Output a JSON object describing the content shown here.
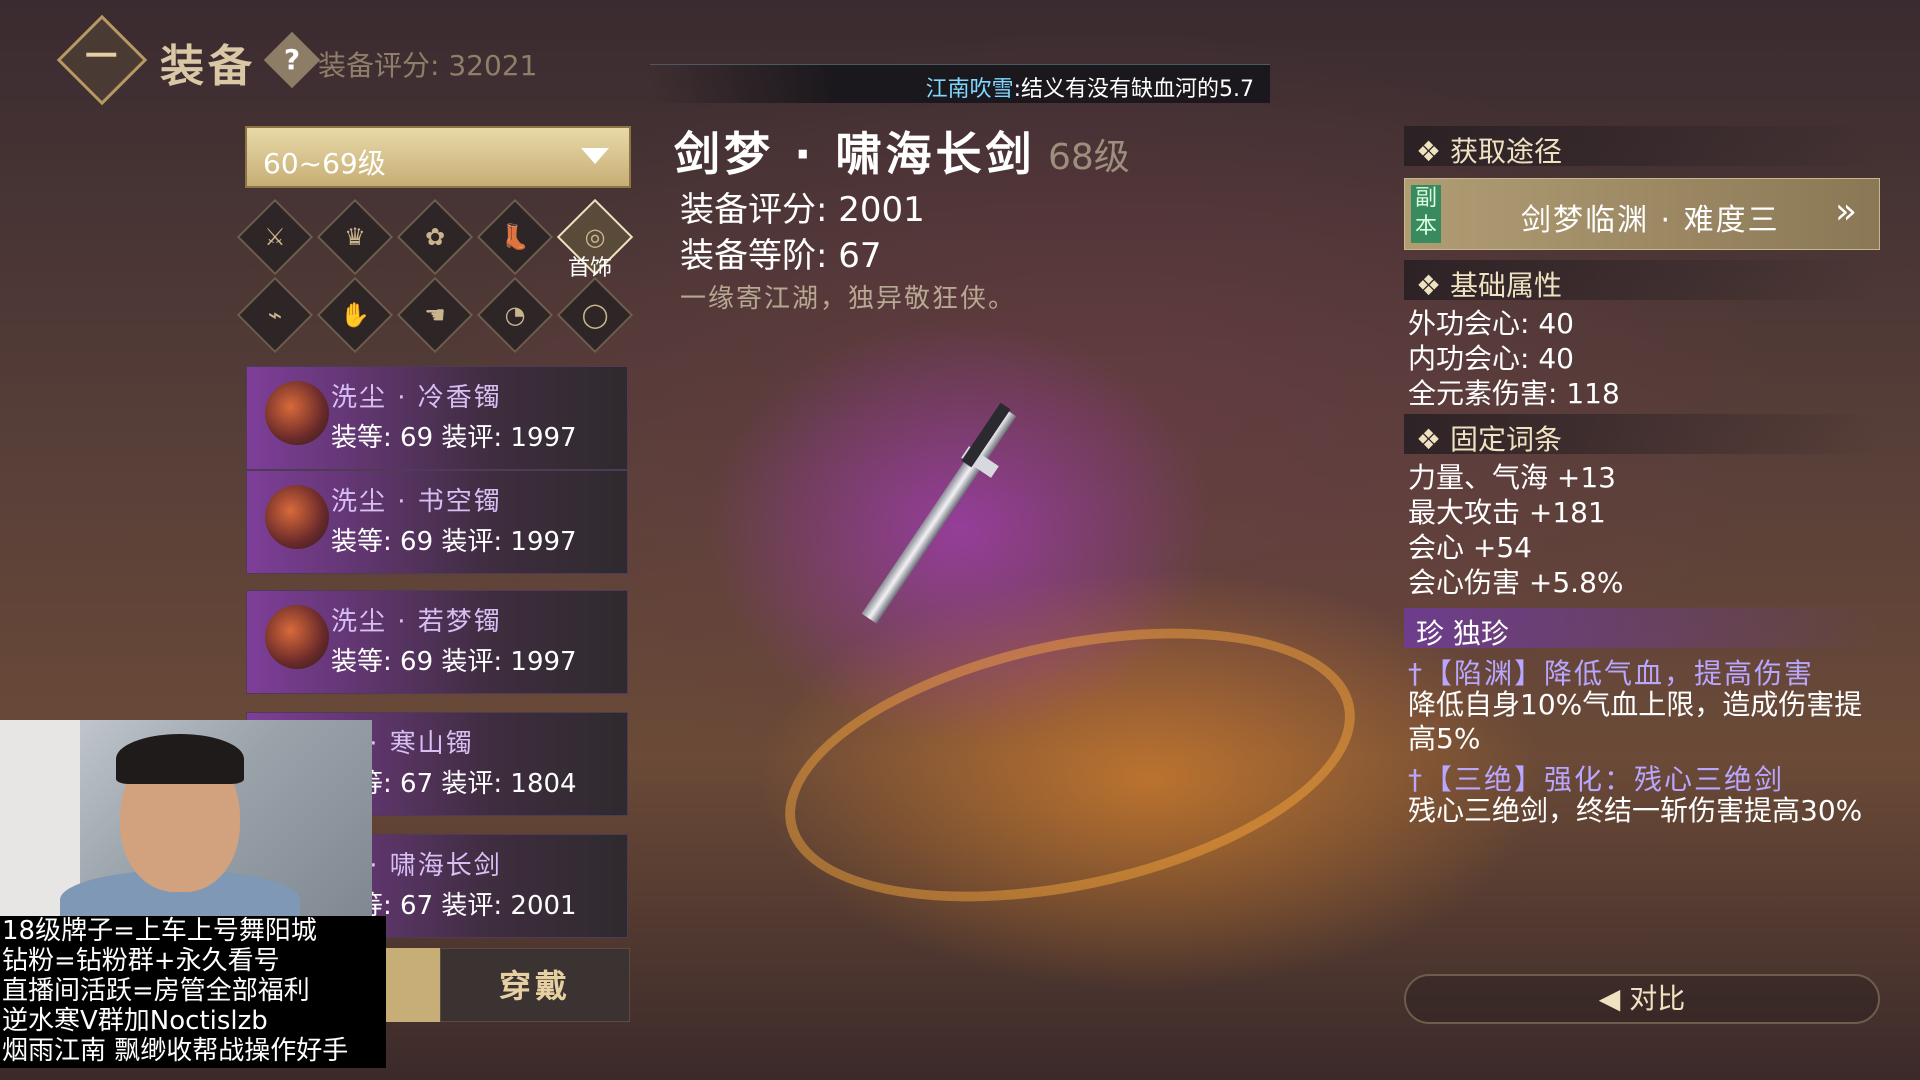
{
  "header": {
    "title": "装备",
    "help_icon": "?",
    "score_label": "装备评分: 32021"
  },
  "chat": {
    "name": "江南吹雪",
    "message": ":结义有没有缺血河的5.7"
  },
  "filter": {
    "level_range": "60~69级"
  },
  "slots": {
    "active_label": "首饰",
    "icons": [
      "sword-icon",
      "hat-icon",
      "bow-icon",
      "boots-icon",
      "ring-icon",
      "bracer-icon",
      "gauntlet-icon",
      "glove-icon",
      "bracelet-icon",
      "necklace-icon"
    ],
    "glyphs": [
      "⚔",
      "♛",
      "✿",
      "👢",
      "◎",
      "⌁",
      "✋",
      "☚",
      "◔",
      "◯"
    ]
  },
  "items": [
    {
      "name": "洗尘 · 冷香镯",
      "stats": "装等: 69  装评: 1997"
    },
    {
      "name": "洗尘 · 书空镯",
      "stats": "装等: 69  装评: 1997"
    },
    {
      "name": "洗尘 · 若梦镯",
      "stats": "装等: 69  装评: 1997"
    },
    {
      "name": "峰 · 寒山镯",
      "stats": "装等: 67  装评: 1804"
    },
    {
      "name": "梦 · 啸海长剑",
      "stats": "装等: 67  装评: 2001"
    }
  ],
  "wear_button": "穿戴",
  "promo": [
    "18级牌子=上车上号舞阳城",
    "钻粉=钻粉群+永久看号",
    "直播间活跃=房管全部福利",
    "逆水寒V群加Noctislzb",
    "烟雨江南 飘缈收帮战操作好手"
  ],
  "detail": {
    "name": "剑梦 · 啸海长剑",
    "level": "68级",
    "score": "装备评分:  2001",
    "tier": "装备等阶:  67",
    "flavor": "一缘寄江湖，独异敬狂侠。"
  },
  "source": {
    "header": "❖ 获取途径",
    "tag": "副本",
    "label": "剑梦临渊 · 难度三",
    "arrow": "»"
  },
  "base_attrs": {
    "header": "❖ 基础属性",
    "items": [
      "外功会心: 40",
      "内功会心: 40",
      "全元素伤害: 118"
    ]
  },
  "fixed_attrs": {
    "header": "❖ 固定词条",
    "items": [
      "力量、气海 +13",
      "最大攻击 +181",
      "会心 +54",
      "会心伤害 +5.8%"
    ]
  },
  "unique": {
    "header": "珍 独珍",
    "skills": [
      {
        "name": "†【陷渊】降低气血，提高伤害",
        "desc": "降低自身10%气血上限，造成伤害提高5%"
      },
      {
        "name": "†【三绝】强化：残心三绝剑",
        "desc": "残心三绝剑，终结一斩伤害提高30%"
      }
    ]
  },
  "compare_button": "◀ 对比"
}
